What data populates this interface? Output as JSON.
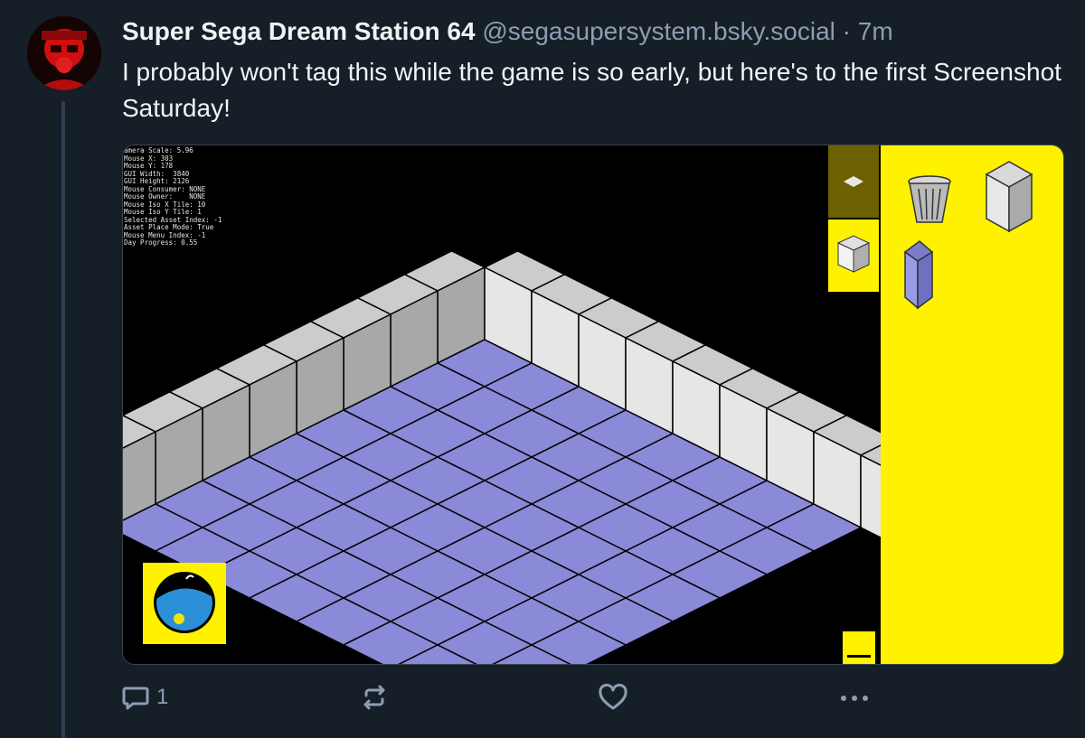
{
  "post": {
    "display_name": "Super Sega Dream Station 64",
    "handle": "@segasupersystem.bsky.social",
    "separator": "·",
    "time": "7m",
    "text": "I probably won't tag this while the game is so early, but here's to the first Screenshot Saturday!"
  },
  "debug_overlay": {
    "lines": [
      "amera Scale: 5.96",
      "Mouse X: 303",
      "Mouse Y: 178",
      "GUI Width:  3840",
      "GUI Height: 2126",
      "Mouse Consumer: NONE",
      "Mouse Owner:    NONE",
      "Mouse Iso X Tile: 10",
      "Mouse Iso Y Tile: 1",
      "Selected Asset Index: -1",
      "Asset Place Mode: True",
      "Mouse Menu Index: -1",
      "Day Progress: 0.55"
    ]
  },
  "game": {
    "floor_grid": 8,
    "colors": {
      "floor": "#8a8ad8",
      "wall_top": "#cccccc",
      "wall_left": "#a8a8a8",
      "wall_right": "#e6e6e6",
      "panel": "#fff200",
      "selected_tab": "#6b6100",
      "blue_cube": "#9a9ae6"
    },
    "day_progress": 0.55,
    "palette_items": [
      "trash-icon",
      "cube-gray-icon",
      "cube-blue-icon"
    ]
  },
  "actions": {
    "reply_count": "1",
    "repost_count": "",
    "like_count": ""
  }
}
